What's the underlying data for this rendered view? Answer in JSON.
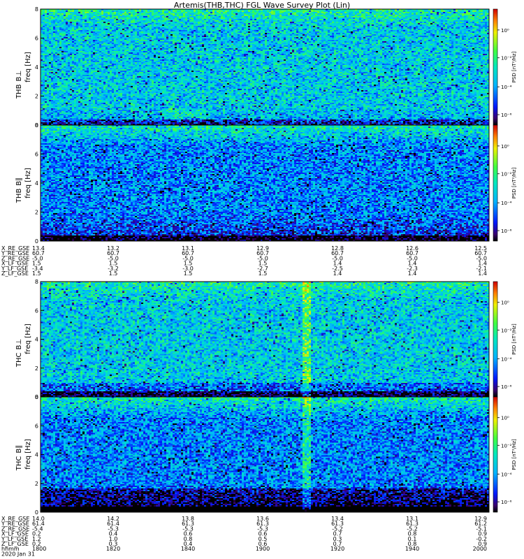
{
  "chart_data": {
    "type": "heatmap",
    "title": "Artemis(THB,THC) FGL Wave Survey Plot (Lin)",
    "colorbar": {
      "label": "PSD [nT²/Hz]",
      "ticks": [
        "10⁰",
        "10⁻²",
        "10⁻⁴",
        "10⁻⁶"
      ],
      "scale": "log"
    },
    "panels": [
      {
        "probe": "THB",
        "component": "B⊥",
        "ylabel": "freq [Hz]",
        "ylim": [
          0,
          8
        ],
        "yticks": [
          "0",
          "2",
          "4",
          "6",
          "8"
        ]
      },
      {
        "probe": "THB",
        "component": "B∥",
        "ylabel": "freq [Hz]",
        "ylim": [
          0,
          8
        ],
        "yticks": [
          "0",
          "2",
          "4",
          "6",
          "8"
        ]
      },
      {
        "probe": "THC",
        "component": "B⊥",
        "ylabel": "freq [Hz]",
        "ylim": [
          0,
          8
        ],
        "yticks": [
          "0",
          "2",
          "4",
          "6",
          "8"
        ]
      },
      {
        "probe": "THC",
        "component": "B∥",
        "ylabel": "freq [Hz]",
        "ylim": [
          0,
          8
        ],
        "yticks": [
          "0",
          "2",
          "4",
          "6",
          "8"
        ]
      }
    ],
    "ephemeris_thb": {
      "rows": [
        {
          "label": "X_RE_GSE",
          "values": [
            "13.4",
            "13.2",
            "13.1",
            "12.9",
            "12.8",
            "12.6",
            "12.5"
          ]
        },
        {
          "label": "Y_RE_GSE",
          "values": [
            "60.7",
            "60.7",
            "60.7",
            "60.7",
            "60.7",
            "60.7",
            "60.7"
          ]
        },
        {
          "label": "Z_RE_GSE",
          "values": [
            "-5.0",
            "-5.0",
            "-5.0",
            "-5.0",
            "-5.0",
            "-5.0",
            "-5.0"
          ]
        },
        {
          "label": "X_LF_GSE",
          "values": [
            "1.5",
            "1.5",
            "1.5",
            "1.5",
            "1.4",
            "1.4",
            "1.4"
          ]
        },
        {
          "label": "Y_LF_GSE",
          "values": [
            "-3.4",
            "-3.2",
            "-3.0",
            "-2.7",
            "-2.5",
            "-2.3",
            "-2.1"
          ]
        },
        {
          "label": "Z_LF_GSE",
          "values": [
            "1.5",
            "1.5",
            "1.5",
            "1.5",
            "1.4",
            "1.4",
            "1.4"
          ]
        }
      ]
    },
    "ephemeris_thc": {
      "rows": [
        {
          "label": "X_RE_GSE",
          "values": [
            "14.0",
            "14.2",
            "13.8",
            "13.6",
            "13.4",
            "13.1",
            "12.9"
          ]
        },
        {
          "label": "Y_RE_GSE",
          "values": [
            "61.4",
            "61.4",
            "61.3",
            "61.3",
            "61.3",
            "61.3",
            "61.2"
          ]
        },
        {
          "label": "Z_RE_GSE",
          "values": [
            "-5.4",
            "-5.3",
            "-5.3",
            "-5.3",
            "-5.2",
            "-5.2",
            "-5.1"
          ]
        },
        {
          "label": "X_LF_GSE",
          "values": [
            "0.2",
            "0.4",
            "0.6",
            "0.6",
            "0.7",
            "0.8",
            "0.9"
          ]
        },
        {
          "label": "Y_LF_GSE",
          "values": [
            "1.2",
            "1.0",
            "0.8",
            "0.5",
            "0.3",
            "0.1",
            "-0.2"
          ]
        },
        {
          "label": "Z_LF_GSE",
          "values": [
            "0.2",
            "0.3",
            "0.4",
            "0.6",
            "0.7",
            "0.8",
            "0.9"
          ]
        }
      ],
      "time_row": {
        "label": "hhmm",
        "values": [
          "1800",
          "1820",
          "1840",
          "1900",
          "1920",
          "1940",
          "2000"
        ]
      },
      "date": "2020 Jan 31"
    },
    "features": {
      "thc_burst_time": "~1911",
      "thb_low_freq_enhancement": "~1830"
    }
  }
}
